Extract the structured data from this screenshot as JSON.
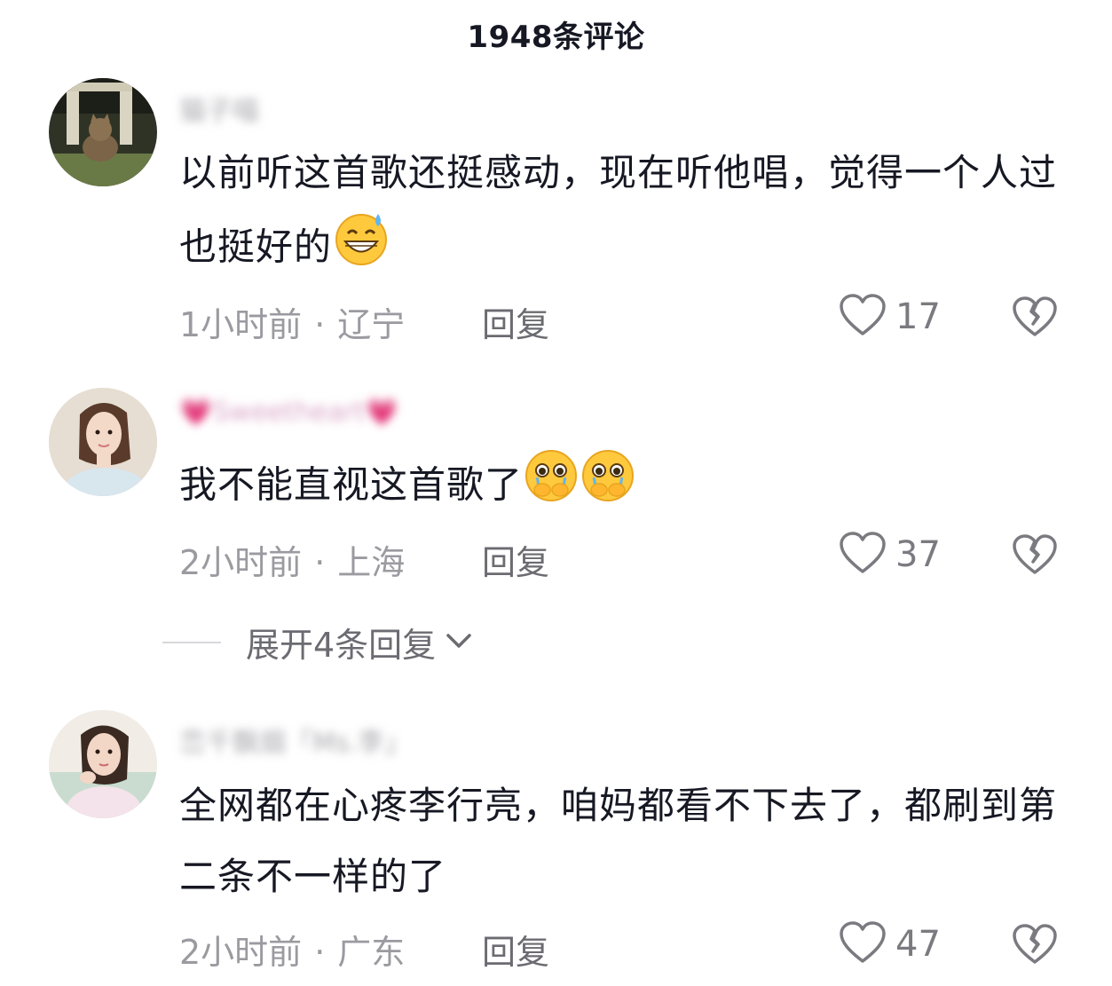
{
  "header": {
    "title": "1948条评论"
  },
  "comments": [
    {
      "username": "猫子喵",
      "text": "以前听这首歌还挺感动，现在听他唱，觉得一个人过也挺好的",
      "emoji": [
        "grin-sweat-icon"
      ],
      "time": "1小时前",
      "location": "辽宁",
      "reply_label": "回复",
      "likes": "17"
    },
    {
      "username": "Sweetheart",
      "text": "我不能直视这首歌了",
      "emoji": [
        "holding-back-tears-icon",
        "holding-back-tears-icon"
      ],
      "time": "2小时前",
      "location": "上海",
      "reply_label": "回复",
      "likes": "37"
    },
    {
      "username": "峦千飘烟「Ms.李」",
      "text": "全网都在心疼李行亮，咱妈都看不下去了，都刷到第二条不一样的了",
      "emoji": [],
      "time": "2小时前",
      "location": "广东",
      "reply_label": "回复",
      "likes": "47"
    }
  ],
  "expand_replies": {
    "label": "展开4条回复"
  }
}
